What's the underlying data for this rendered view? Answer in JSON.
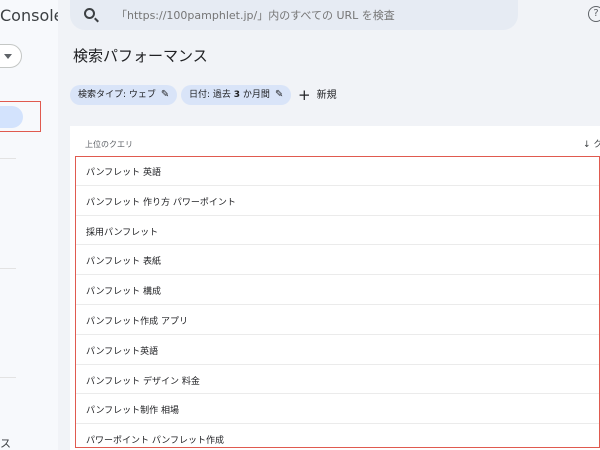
{
  "app": {
    "brand_suffix": "Console"
  },
  "sidebar": {
    "bottom_text": "ス"
  },
  "search": {
    "placeholder": "「https://100pamphlet.jp/」内のすべての URL を検査"
  },
  "header": {
    "help_glyph": "?"
  },
  "page": {
    "title": "検索パフォーマンス"
  },
  "filters": {
    "search_type_label": "検索タイプ: ウェブ",
    "date_label_prefix": "日付: 過去",
    "date_label_bold": "3",
    "date_label_suffix": "か月間",
    "new_label": "新規",
    "plus_glyph": "+",
    "edit_glyph": "✎"
  },
  "table": {
    "column_query": "上位のクエリ",
    "column_sort": "↓ ク",
    "rows": [
      "パンフレット 英語",
      "パンフレット 作り方 パワーポイント",
      "採用パンフレット",
      "パンフレット 表紙",
      "パンフレット 構成",
      "パンフレット作成 アプリ",
      "パンフレット英語",
      "パンフレット デザイン 料金",
      "パンフレット制作 相場",
      "パワーポイント パンフレット作成"
    ]
  },
  "colors": {
    "highlight_border": "#e05a4f",
    "chip_bg": "#d9e4f8",
    "active_nav_bg": "#d3e3fd",
    "background": "#f1f3f7"
  }
}
